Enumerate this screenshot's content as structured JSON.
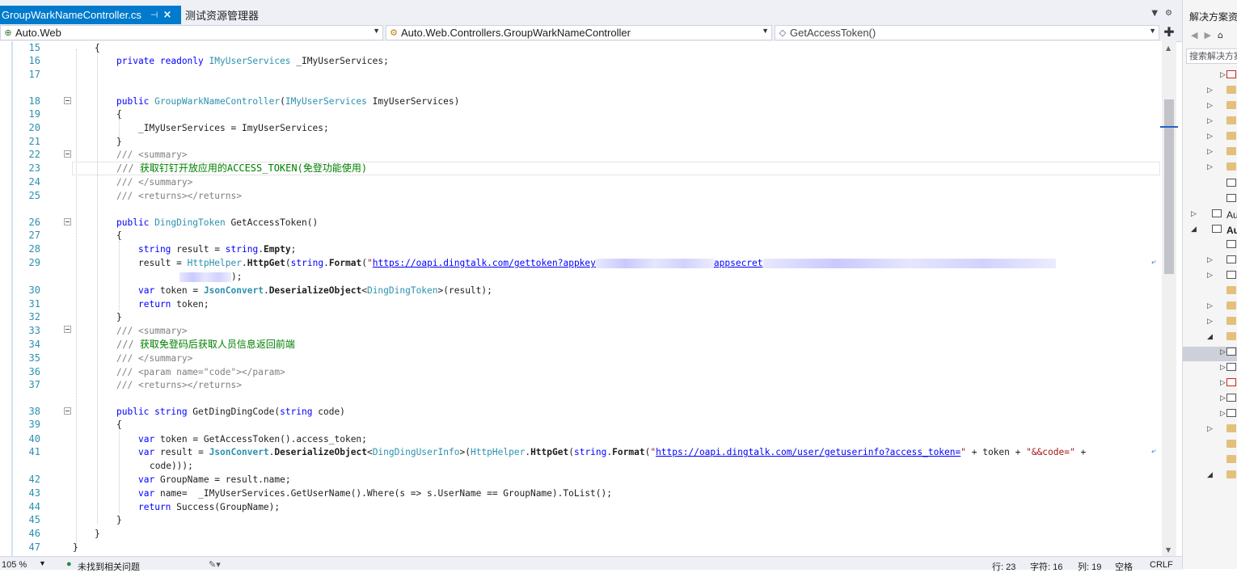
{
  "tabs": {
    "active_label": "GroupWarkNameController.cs",
    "inactive_label": "测试资源管理器",
    "pin_glyph": "⊣",
    "close_glyph": "×"
  },
  "nav": {
    "project": "Auto.Web",
    "type": "Auto.Web.Controllers.GroupWarkNameController",
    "member": "GetAccessToken()"
  },
  "editor": {
    "line_numbers": [
      "15",
      "16",
      "17",
      "18",
      "19",
      "20",
      "21",
      "22",
      "23",
      "24",
      "25",
      "26",
      "27",
      "28",
      "29",
      "30",
      "31",
      "32",
      "33",
      "34",
      "35",
      "36",
      "37",
      "38",
      "39",
      "40",
      "41",
      "42",
      "43",
      "44",
      "45",
      "46",
      "47"
    ],
    "code": {
      "l15": "{",
      "l16_kw": "private readonly ",
      "l16_ty": "IMyUserServices",
      "l16_rest": " _IMyUserServices;",
      "l18_kw": "public ",
      "l18_ty": "GroupWarkNameController",
      "l18_p1": "(",
      "l18_ty2": "IMyUserServices",
      "l18_p2": " ImyUserServices)",
      "l19": "{",
      "l20": "_IMyUserServices = ImyUserServices;",
      "l21": "}",
      "l22_slash": "/// ",
      "l22_tag": "<summary>",
      "l23_slash": "/// ",
      "l23_text": "获取钉钉开放应用的ACCESS_TOKEN(免登功能使用)",
      "l24_slash": "/// ",
      "l24_tag": "</summary>",
      "l25_slash": "/// ",
      "l25_tag": "<returns></returns>",
      "l26_kw": "public ",
      "l26_ty": "DingDingToken",
      "l26_rest": " GetAccessToken()",
      "l27": "{",
      "l28_kw": "string",
      "l28_mid": " result = ",
      "l28_kw2": "string",
      "l28_dot": ".",
      "l28_b": "Empty",
      "l28_end": ";",
      "l29_pre": "result = ",
      "l29_ty": "HttpHelper",
      "l29_dot": ".",
      "l29_b": "HttpGet",
      "l29_p": "(",
      "l29_kw": "string",
      "l29_dot2": ".",
      "l29_b2": "Format",
      "l29_p2": "(",
      "l29_q": "\"",
      "l29_url": "https://oapi.dingtalk.com/gettoken?appkey",
      "l29_url2": "appsecret",
      "l29_cont": ");",
      "l30_kw": "var",
      "l30_mid": " token = ",
      "l30_ty": "JsonConvert",
      "l30_dot": ".",
      "l30_b": "DeserializeObject",
      "l30_lt": "<",
      "l30_ty2": "DingDingToken",
      "l30_end": ">(result);",
      "l31_kw": "return",
      "l31_rest": " token;",
      "l32": "}",
      "l33_slash": "/// ",
      "l33_tag": "<summary>",
      "l34_slash": "/// ",
      "l34_text": "获取免登码后获取人员信息返回前端",
      "l35_slash": "/// ",
      "l35_tag": "</summary>",
      "l36_slash": "/// ",
      "l36_tag": "<param name=\"code\"></param>",
      "l37_slash": "/// ",
      "l37_tag": "<returns></returns>",
      "l38_kw": "public string ",
      "l38_rest": "GetDingDingCode(",
      "l38_kw2": "string",
      "l38_end": " code)",
      "l39": "{",
      "l40_kw": "var",
      "l40_rest": " token = GetAccessToken().access_token;",
      "l41_kw": "var",
      "l41_mid": " result = ",
      "l41_ty": "JsonConvert",
      "l41_dot": ".",
      "l41_b": "DeserializeObject",
      "l41_lt": "<",
      "l41_ty2": "DingDingUserInfo",
      "l41_p": ">(",
      "l41_ty3": "HttpHelper",
      "l41_dot2": ".",
      "l41_b2": "HttpGet",
      "l41_p2": "(",
      "l41_kw2": "string",
      "l41_dot3": ".",
      "l41_b3": "Format",
      "l41_p3": "(",
      "l41_q": "\"",
      "l41_url": "https://oapi.dingtalk.com/user/getuserinfo?access_token=",
      "l41_q2": "\"",
      "l41_plus": " + token + ",
      "l41_st": "\"&&code=\"",
      "l41_plus2": " +",
      "l41_cont": "code)));",
      "l42_kw": "var",
      "l42_rest": " GroupName = result.name;",
      "l43_kw": "var",
      "l43_rest": " name=  _IMyUserServices.GetUserName().Where(s => s.UserName == GroupName).ToList();",
      "l44_kw": "return",
      "l44_rest": " Success(GroupName);",
      "l45": "}",
      "l46": "}",
      "l47": "}"
    }
  },
  "statusbar": {
    "zoom": "105 %",
    "issues": "未找到相关问题",
    "line": "行: 23",
    "char": "字符: 16",
    "col": "列: 19",
    "ins": "空格",
    "eol": "CRLF"
  },
  "solution": {
    "title": "解决方案资源管理器",
    "search_placeholder": "搜索解决方案资源管理器",
    "item_au1": "Au",
    "item_au2": "Auto.Web"
  },
  "colors": {
    "accent": "#007acc",
    "keyword": "#0000ff",
    "type": "#2b91af",
    "comment": "#008000",
    "string": "#a31515"
  }
}
